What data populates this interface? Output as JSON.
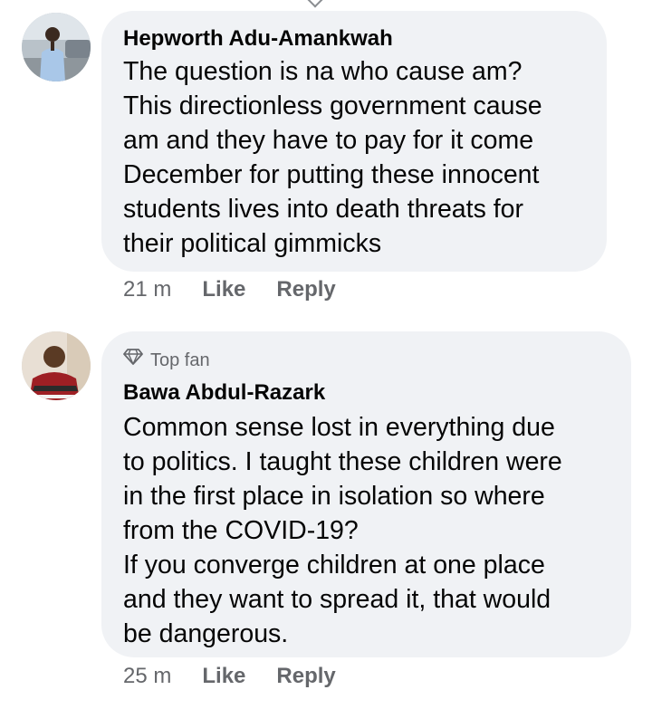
{
  "comments": [
    {
      "author": "Hepworth Adu-Amankwah",
      "badge": "",
      "lines": [
        "The question is na who cause am?",
        "This directionless government cause",
        "am and they have to pay for it come",
        "December for putting these innocent",
        "students lives into death threats for",
        "their political gimmicks"
      ],
      "time": "21 m",
      "like_label": "Like",
      "reply_label": "Reply"
    },
    {
      "author": "Bawa Abdul-Razark",
      "badge": "Top fan",
      "badge_icon": "diamond-icon",
      "lines": [
        "Common sense lost in everything due",
        "to politics. I taught these children were",
        "in the first place in isolation so where",
        "from the COVID-19?",
        "If you converge children at one place",
        "and they want to spread it, that would",
        "be dangerous."
      ],
      "time": "25 m",
      "like_label": "Like",
      "reply_label": "Reply"
    }
  ],
  "colors": {
    "bubble": "#f0f2f5",
    "secondary_text": "#65676b",
    "primary_text": "#050505"
  }
}
